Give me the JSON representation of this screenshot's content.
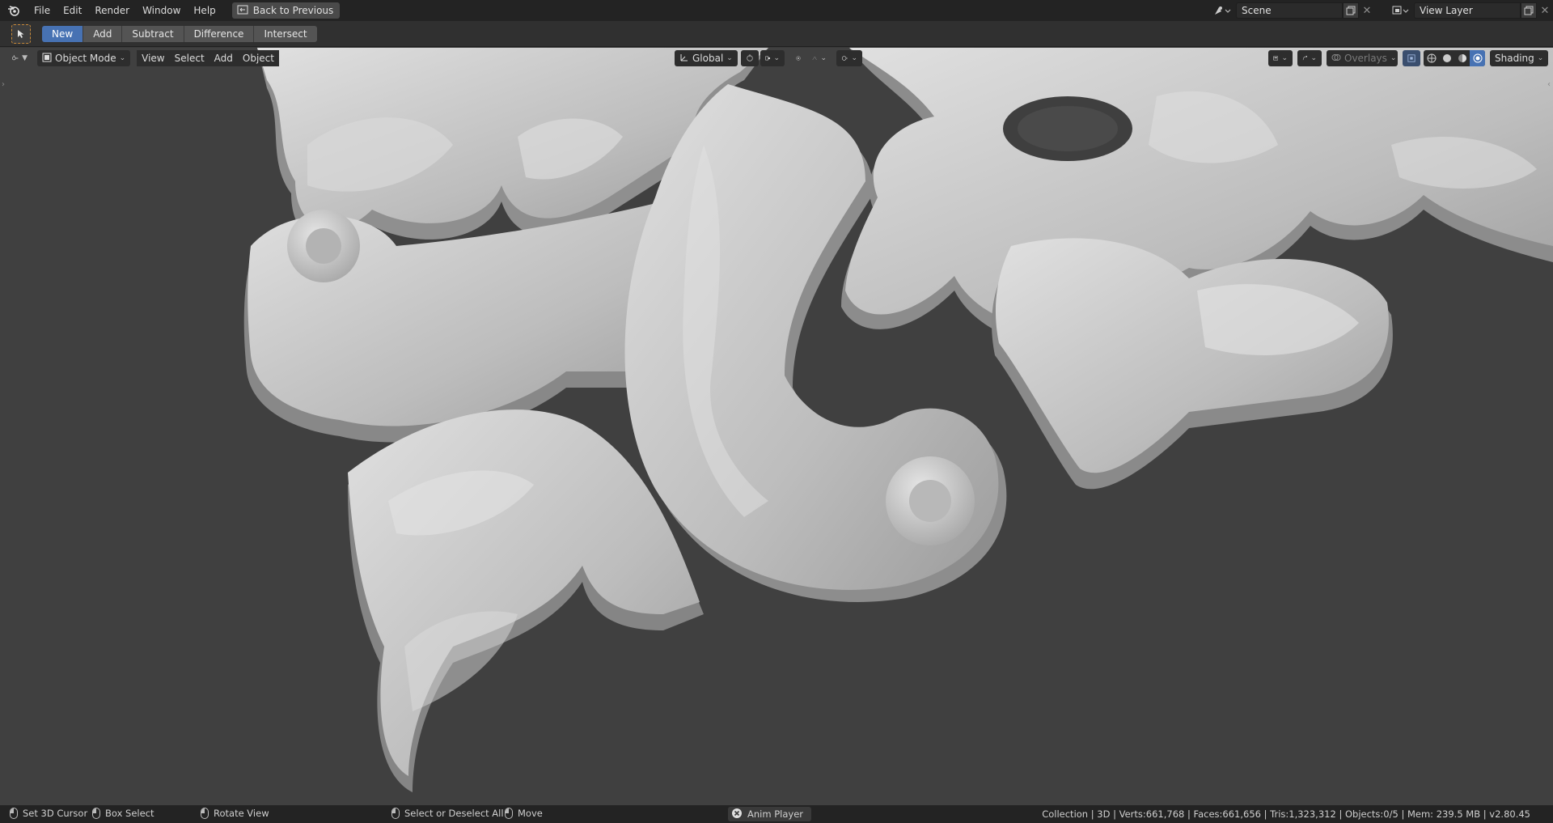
{
  "topbar": {
    "logo_icon": "blender-logo-icon",
    "menus": [
      "File",
      "Edit",
      "Render",
      "Window",
      "Help"
    ],
    "back_button": "Back to Previous",
    "scene": {
      "value": "Scene"
    },
    "view_layer": {
      "value": "View Layer"
    }
  },
  "tool_header": {
    "operations": [
      "New",
      "Add",
      "Subtract",
      "Difference",
      "Intersect"
    ],
    "active_operation": "New"
  },
  "viewport_header": {
    "mode": "Object Mode",
    "menus": [
      "View",
      "Select",
      "Add",
      "Object"
    ],
    "transform_orientation": "Global",
    "overlays_label": "Overlays",
    "shading_label": "Shading"
  },
  "statusbar": {
    "hints": [
      "Set 3D Cursor",
      "Box Select",
      "Rotate View",
      "Select or Deselect All",
      "Move"
    ],
    "anim_player": "Anim Player",
    "stats": "Collection | 3D | Verts:661,768 | Faces:661,656 | Tris:1,323,312 | Objects:0/5 | Mem: 239.5 MB | v2.80.45"
  },
  "colors": {
    "accent_blue": "#4772b3",
    "viewport_bg": "#3f3f3f",
    "mesh": "#c9c9c9"
  }
}
